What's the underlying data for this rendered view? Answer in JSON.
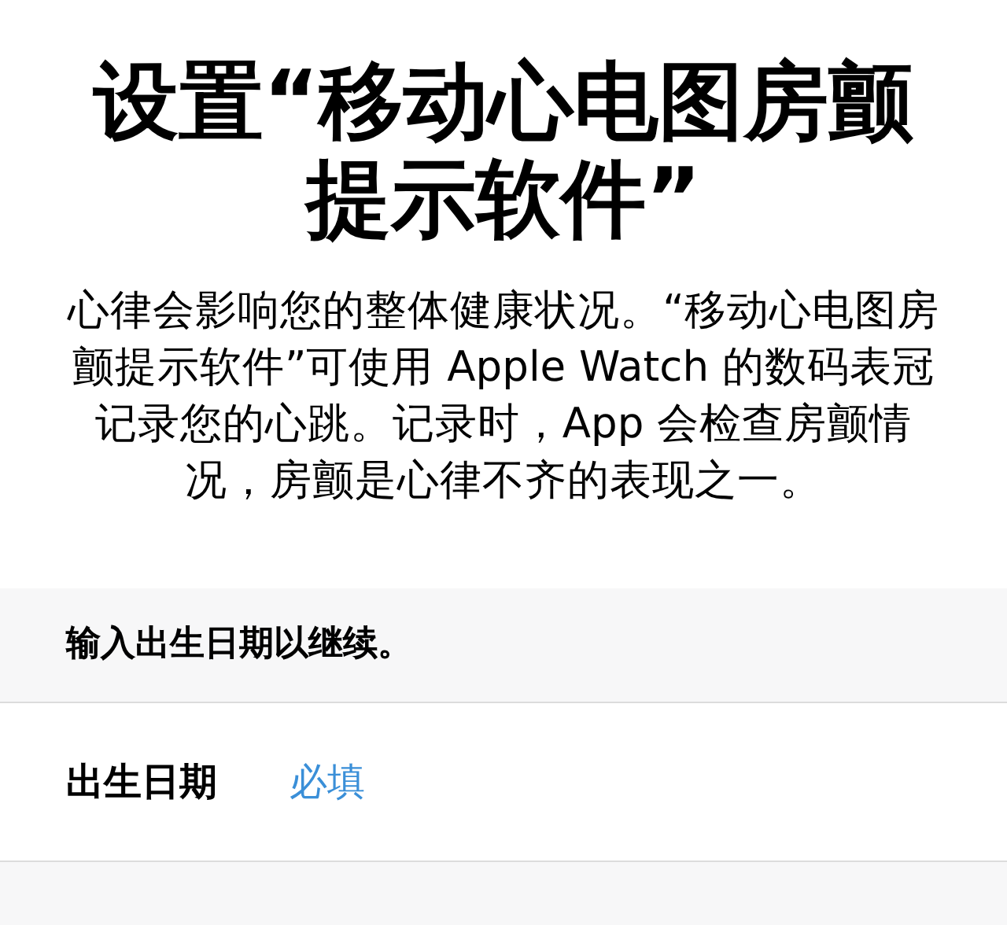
{
  "title": "设置“移动心电图房颤提示软件”",
  "description": "心律会影响您的整体健康状况。“移动心电图房颤提示软件”可使用 Apple Watch 的数码表冠记录您的心跳。记录时，App 会检查房颤情况，房颤是心律不齐的表现之一。",
  "section_header": "输入出生日期以继续。",
  "fields": [
    {
      "label": "出生日期",
      "placeholder": "必填"
    }
  ]
}
